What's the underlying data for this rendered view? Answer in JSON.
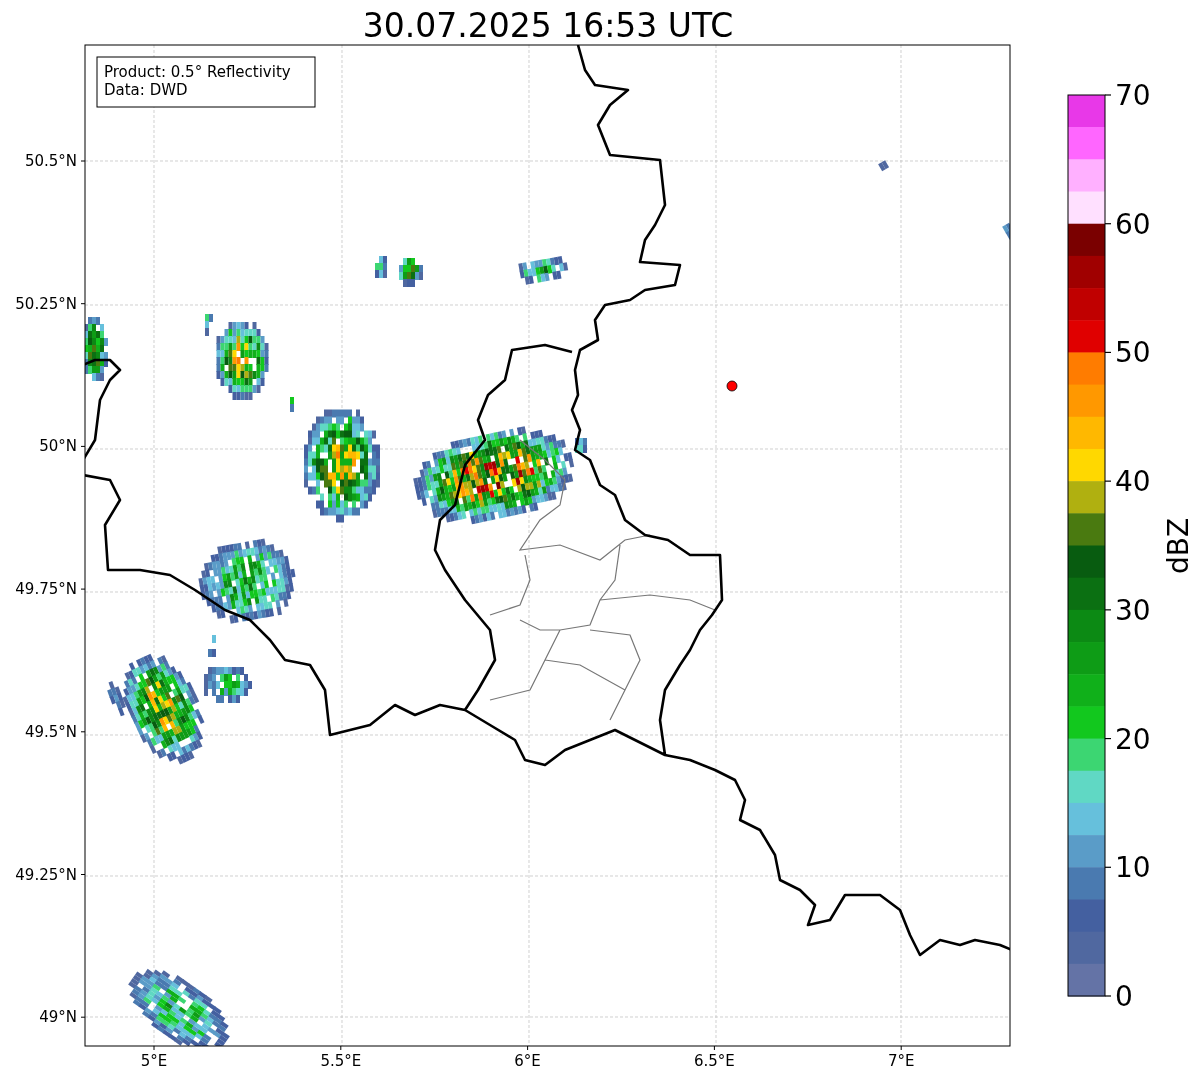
{
  "title": "30.07.2025 16:53 UTC",
  "info_box": [
    "Product: 0.5° Reflectivity",
    "Data: DWD"
  ],
  "yticks": [
    "50.5°N",
    "50.25°N",
    "50°N",
    "49.75°N",
    "49.5°N",
    "49.25°N",
    "49°N"
  ],
  "xticks": [
    "5°E",
    "5.5°E",
    "6°E",
    "6.5°E",
    "7°E"
  ],
  "colorbar": {
    "label": "dBZ",
    "ticks": [
      "70",
      "60",
      "50",
      "40",
      "30",
      "20",
      "10",
      "0"
    ],
    "bands": [
      {
        "color": "#e838e8"
      },
      {
        "color": "#ff66ff"
      },
      {
        "color": "#ffb0ff"
      },
      {
        "color": "#ffe0ff"
      },
      {
        "color": "#7a0000"
      },
      {
        "color": "#a00000"
      },
      {
        "color": "#c00000"
      },
      {
        "color": "#e00000"
      },
      {
        "color": "#ff7c00"
      },
      {
        "color": "#ff9800"
      },
      {
        "color": "#ffb800"
      },
      {
        "color": "#ffd800"
      },
      {
        "color": "#b0b010"
      },
      {
        "color": "#4a7a10"
      },
      {
        "color": "#085c10"
      },
      {
        "color": "#0b7012"
      },
      {
        "color": "#0c8a14"
      },
      {
        "color": "#0e9c16"
      },
      {
        "color": "#10b01a"
      },
      {
        "color": "#12c81e"
      },
      {
        "color": "#3cd672"
      },
      {
        "color": "#60d8c4"
      },
      {
        "color": "#66c0dc"
      },
      {
        "color": "#5a9cc8"
      },
      {
        "color": "#4a7ab0"
      },
      {
        "color": "#4460a0"
      },
      {
        "color": "#5068a0"
      },
      {
        "color": "#6473a6"
      }
    ]
  }
}
